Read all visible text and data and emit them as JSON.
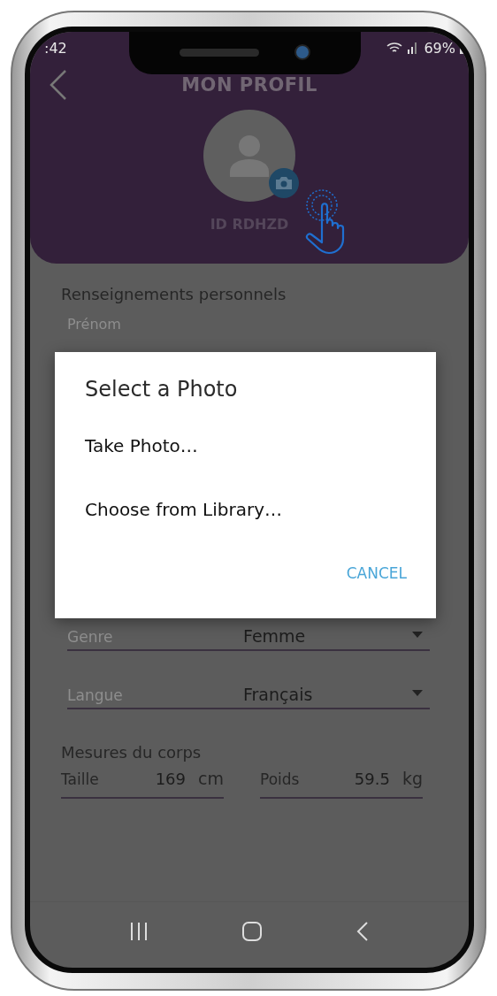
{
  "status_bar": {
    "time": ":42",
    "battery": "69%"
  },
  "header": {
    "title": "MON PROFIL",
    "user_id": "ID RDHZD"
  },
  "personal": {
    "title": "Renseignements personnels",
    "first_name_label": "Prénom"
  },
  "selects": [
    {
      "label": "Genre",
      "value": "Femme"
    },
    {
      "label": "Langue",
      "value": "Français"
    }
  ],
  "measures": {
    "title": "Mesures du corps",
    "items": [
      {
        "label": "Taille",
        "value": "169",
        "unit": "cm"
      },
      {
        "label": "Poids",
        "value": "59.5",
        "unit": "kg"
      }
    ]
  },
  "dialog": {
    "title": "Select a Photo",
    "options": [
      "Take Photo…",
      "Choose from Library…"
    ],
    "cancel": "CANCEL"
  }
}
